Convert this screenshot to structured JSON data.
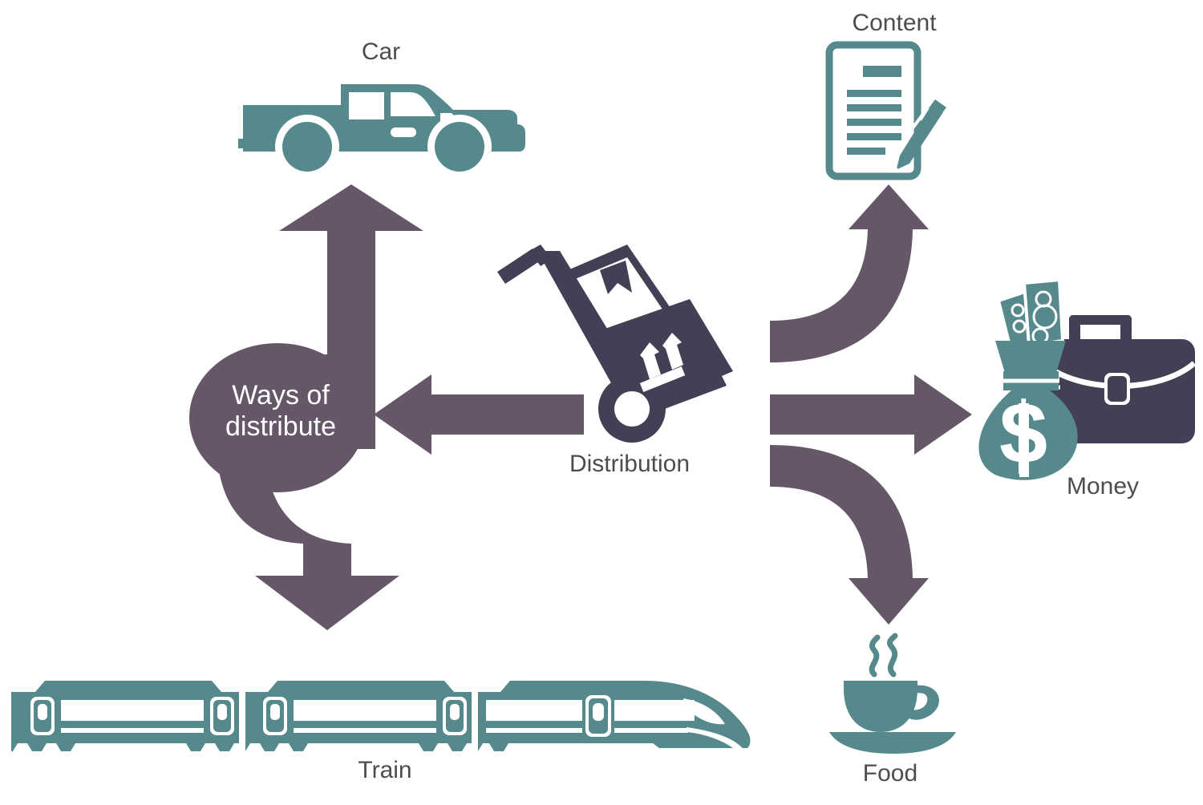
{
  "diagram": {
    "title": "Ways of distribute",
    "background_color": "#ffffff",
    "palette": {
      "teal": "#55898c",
      "purple": "#655768",
      "navy": "#434055",
      "label_gray": "#4d4d4d",
      "white": "#ffffff"
    },
    "hub": {
      "name": "ways-of-distribute-hub",
      "text": "Ways of\ndistribute",
      "line1": "Ways of",
      "line2": "distribute",
      "color": "#655768",
      "text_color": "#ffffff"
    },
    "source": {
      "name": "distribution",
      "label": "Distribution",
      "icon": "hand-truck-icon",
      "color": "#434055"
    },
    "nodes": [
      {
        "id": "car",
        "label": "Car",
        "icon": "pickup-truck-icon",
        "color": "#55898c",
        "side": "left",
        "position": "top"
      },
      {
        "id": "train",
        "label": "Train",
        "icon": "high-speed-train-icon",
        "color": "#55898c",
        "side": "left",
        "position": "bottom"
      },
      {
        "id": "content",
        "label": "Content",
        "icon": "document-with-pen-icon",
        "color": "#55898c",
        "side": "right",
        "position": "top"
      },
      {
        "id": "money",
        "label": "Money",
        "icon": "money-bag-briefcase-icon",
        "color": "#55898c",
        "accent_color": "#434055",
        "side": "right",
        "position": "middle"
      },
      {
        "id": "food",
        "label": "Food",
        "icon": "coffee-cup-icon",
        "color": "#55898c",
        "side": "right",
        "position": "bottom"
      }
    ],
    "arrows": [
      {
        "name": "arrow-distribution-to-hub",
        "shape": "straight",
        "direction": "left",
        "color": "#655768",
        "from": "distribution",
        "to": "ways-of-distribute"
      },
      {
        "name": "arrow-hub-to-car",
        "shape": "curved",
        "direction": "up",
        "color": "#655768",
        "from": "ways-of-distribute",
        "to": "car"
      },
      {
        "name": "arrow-hub-to-train",
        "shape": "curved",
        "direction": "down",
        "color": "#655768",
        "from": "ways-of-distribute",
        "to": "train"
      },
      {
        "name": "arrow-distribution-to-content",
        "shape": "curved",
        "direction": "up",
        "color": "#655768",
        "from": "distribution",
        "to": "content"
      },
      {
        "name": "arrow-distribution-to-money",
        "shape": "straight",
        "direction": "right",
        "color": "#655768",
        "from": "distribution",
        "to": "money"
      },
      {
        "name": "arrow-distribution-to-food",
        "shape": "curved",
        "direction": "down",
        "color": "#655768",
        "from": "distribution",
        "to": "food"
      }
    ]
  }
}
